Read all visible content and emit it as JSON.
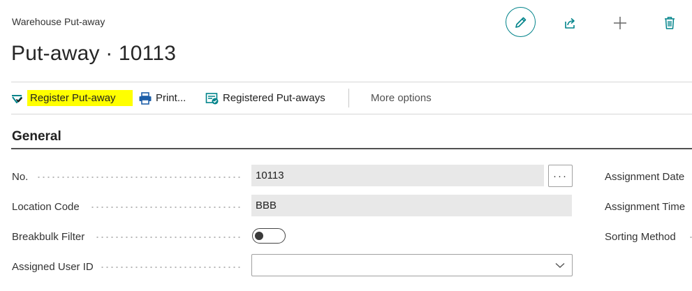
{
  "header": {
    "caption": "Warehouse Put-away",
    "title": "Put-away · 10113"
  },
  "top_actions": {
    "edit_icon": "pencil-icon",
    "share_icon": "share-icon",
    "new_icon": "plus-icon",
    "delete_icon": "trash-icon",
    "accent_color": "#00838a"
  },
  "action_bar": {
    "register_label": "Register Put-away",
    "print_label": "Print...",
    "registered_label": "Registered Put-aways",
    "more_label": "More options",
    "highlight_color": "#ffff00"
  },
  "general": {
    "title": "General",
    "fields": {
      "no": {
        "label": "No.",
        "value": "10113",
        "lookup_label": "···"
      },
      "location_code": {
        "label": "Location Code",
        "value": "BBB"
      },
      "breakbulk_filter": {
        "label": "Breakbulk Filter",
        "value": false
      },
      "assigned_user_id": {
        "label": "Assigned User ID",
        "value": ""
      }
    },
    "right_fields": {
      "assignment_date": {
        "label": "Assignment Date"
      },
      "assignment_time": {
        "label": "Assignment Time"
      },
      "sorting_method": {
        "label": "Sorting Method"
      }
    }
  }
}
